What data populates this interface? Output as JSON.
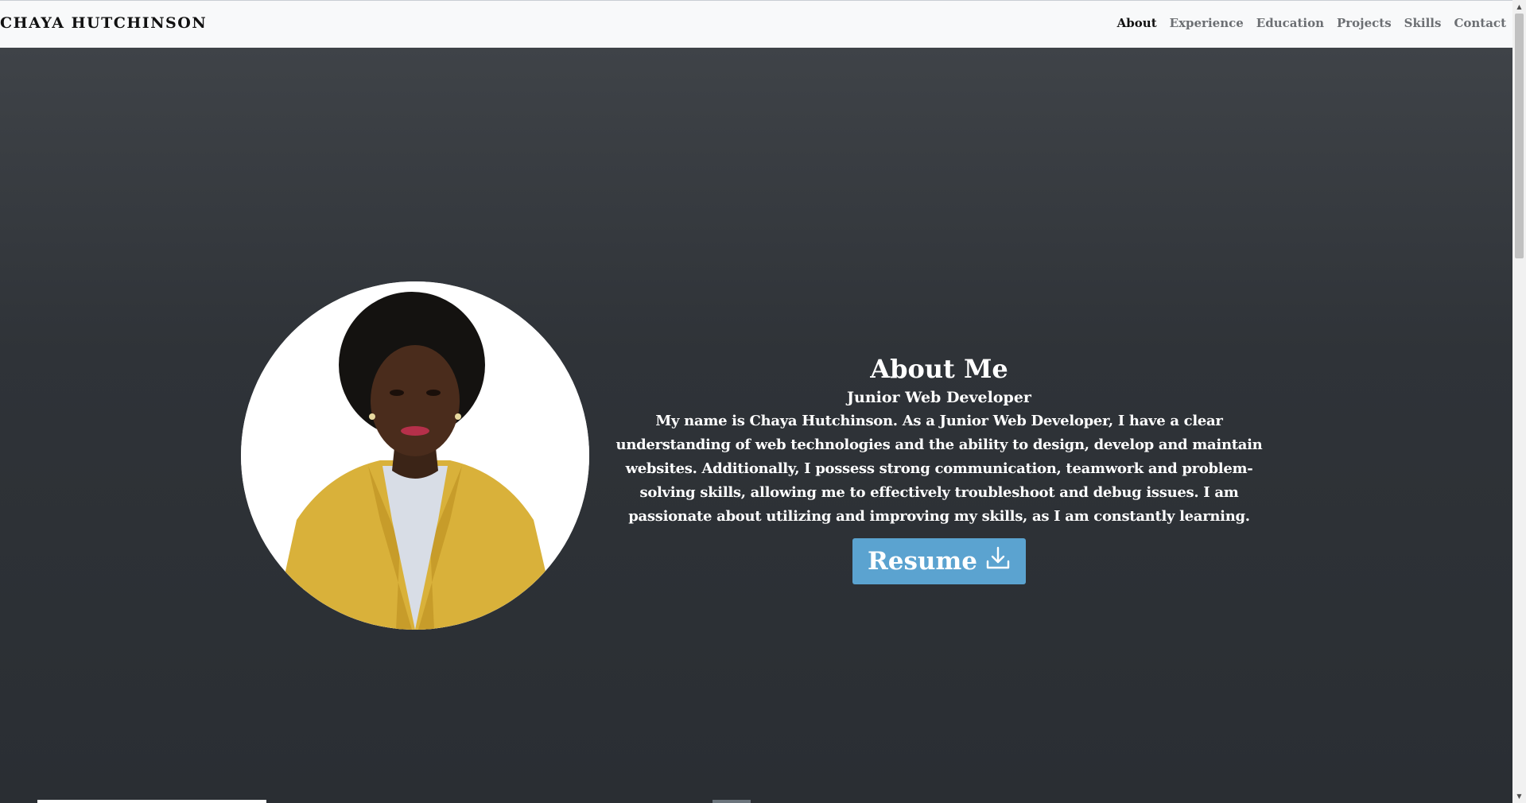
{
  "navbar": {
    "brand": "CHAYA HUTCHINSON",
    "links": [
      {
        "label": "About",
        "active": true
      },
      {
        "label": "Experience",
        "active": false
      },
      {
        "label": "Education",
        "active": false
      },
      {
        "label": "Projects",
        "active": false
      },
      {
        "label": "Skills",
        "active": false
      },
      {
        "label": "Contact",
        "active": false
      }
    ]
  },
  "about": {
    "title": "About Me",
    "subtitle": "Junior Web Developer",
    "bio": "My name is Chaya Hutchinson. As a Junior Web Developer, I have a clear understanding of web technologies and the ability to design, develop and maintain websites. Additionally, I possess strong communication, teamwork and problem-solving skills, allowing me to effectively troubleshoot and debug issues. I am passionate about utilizing and improving my skills, as I am constantly learning.",
    "resume_label": "Resume",
    "resume_icon": "download-icon"
  },
  "colors": {
    "navbar_bg": "#f8f9fa",
    "hero_bg": "#343a40",
    "button_bg": "#5ba3d0",
    "text_light": "#ffffff",
    "nav_active": "#111111",
    "nav_inactive": "#6c6f73"
  }
}
